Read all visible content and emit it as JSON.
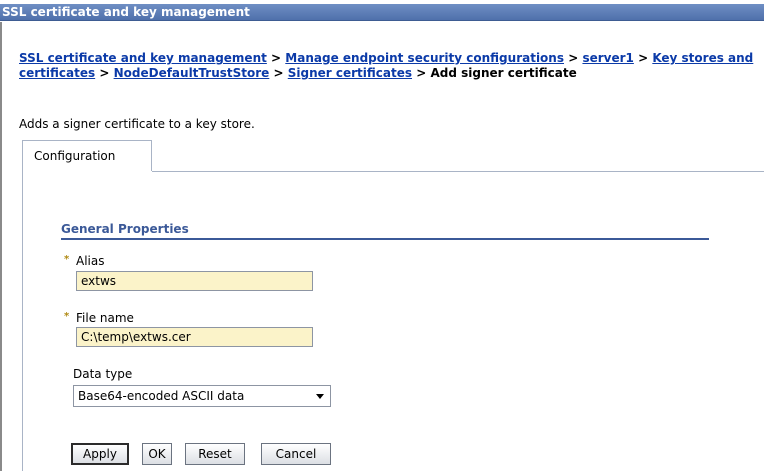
{
  "window": {
    "title": "SSL certificate and key management"
  },
  "breadcrumb": {
    "links": [
      "SSL certificate and key management",
      "Manage endpoint security configurations",
      "server1",
      "Key stores and certificates",
      "NodeDefaultTrustStore",
      "Signer certificates"
    ],
    "separator": ">",
    "current": "Add signer certificate"
  },
  "description": "Adds a signer certificate to a key store.",
  "tabs": [
    {
      "label": "Configuration",
      "active": true
    }
  ],
  "general_properties": {
    "title": "General Properties",
    "alias": {
      "label": "Alias",
      "value": "extws",
      "required": true
    },
    "file_name": {
      "label": "File name",
      "value": "C:\\temp\\extws.cer",
      "required": true
    },
    "data_type": {
      "label": "Data type",
      "selected": "Base64-encoded ASCII data"
    }
  },
  "required_marker": "*",
  "buttons": {
    "apply": "Apply",
    "ok": "OK",
    "reset": "Reset",
    "cancel": "Cancel"
  },
  "colors": {
    "title_bar": "#5c7db8",
    "link": "#0b3aa8",
    "section_title": "#3b5998",
    "field_bg": "#fbf3c9",
    "required_marker": "#b08a14"
  }
}
